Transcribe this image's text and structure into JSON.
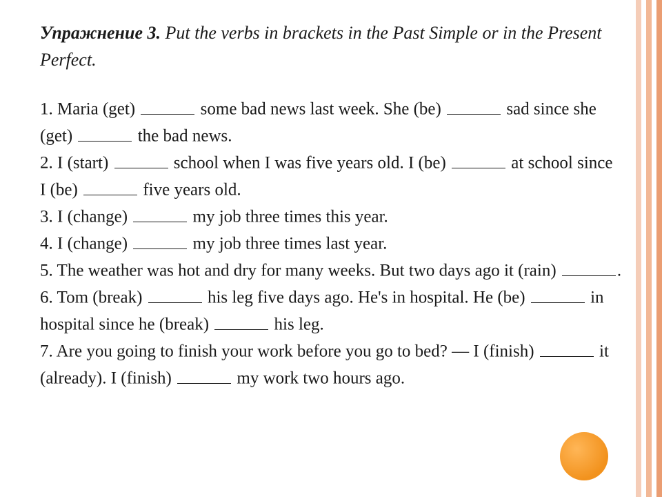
{
  "title": {
    "label": "Упражнение 3.",
    "instruction": " Put the verbs in brackets in the Past Simple or in the Present Perfect."
  },
  "questions": {
    "q1": {
      "num": "1.",
      "p1": " Maria (get) ",
      "p2": " some bad news last week. She (be) ",
      "p3": " sad since she (get) ",
      "p4": "  the bad news."
    },
    "q2": {
      "num": "2.",
      "p1": " I  (start) ",
      "p2": "  school when I was five years old. I (be) ",
      "p3": "  at school since I (be) ",
      "p4": "  five years old."
    },
    "q3": {
      "num": "3.",
      "p1": " I  (change) ",
      "p2": " my job three times this year."
    },
    "q4": {
      "num": "4.",
      "p1": " I  (change) ",
      "p2": "  my job three times last year."
    },
    "q5": {
      "num": "5.",
      "p1": "  The weather was hot and dry for many weeks. But two days ago it (rain) ",
      "p2": "."
    },
    "q6": {
      "num": "6.",
      "p1": "  Tom (break) ",
      "p2": "  his leg five days ago. He's in hospital. He (be) ",
      "p3": "  in hospital since he (break) ",
      "p4": "  his leg."
    },
    "q7": {
      "num": "7.",
      "p1": "  Are you going to finish your work before you go to bed? — I (finish) ",
      "p2": "  it (already). I (finish) ",
      "p3": "  my work two hours ago."
    }
  },
  "colors": {
    "accent": "#f2921d",
    "stripe_light": "#f5cdb8",
    "stripe_mid": "#f2b896",
    "stripe_dark": "#ea9d72"
  }
}
